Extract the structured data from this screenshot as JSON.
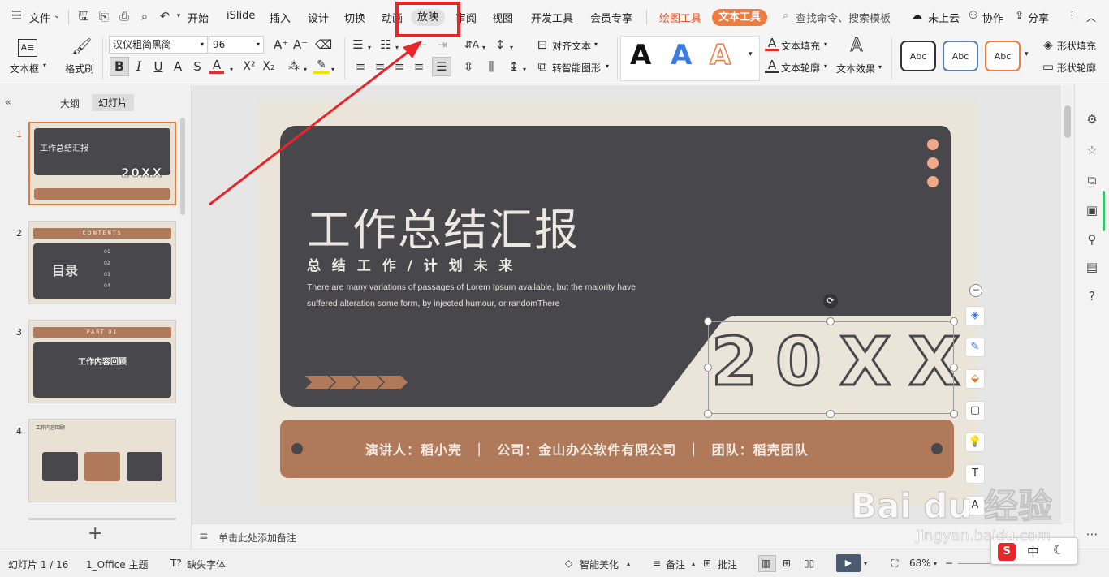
{
  "menu": {
    "file_label": "文件",
    "tabs": [
      "开始",
      "iSlide",
      "插入",
      "设计",
      "切换",
      "动画",
      "放映",
      "审阅",
      "视图",
      "开发工具",
      "会员专享"
    ],
    "active_tab": "放映",
    "drawing_tools": "绘图工具",
    "text_tools": "文本工具",
    "search_placeholder": "查找命令、搜索模板",
    "cloud_label": "未上云",
    "collab_label": "协作",
    "share_label": "分享"
  },
  "ribbon": {
    "textbox_label": "文本框",
    "format_painter_label": "格式刷",
    "font_name": "汉仪粗简黑简",
    "font_size": "96",
    "align_text_label": "对齐文本",
    "smart_shape_label": "转智能图形",
    "text_fill_label": "文本填充",
    "text_outline_label": "文本轮廓",
    "text_effect_label": "文本效果",
    "shape_fill_label": "形状填充",
    "shape_outline_label": "形状轮廓",
    "style_sample": "Abc",
    "wordart_letter": "A"
  },
  "left_pane": {
    "outline_tab": "大纲",
    "slides_tab": "幻灯片",
    "add_label": "+",
    "slides": [
      {
        "num": "1",
        "title": "工作总结汇报",
        "year": "20XX"
      },
      {
        "num": "2",
        "title": "目录",
        "header": "CONTENTS",
        "items": [
          "01",
          "02",
          "03",
          "04"
        ]
      },
      {
        "num": "3",
        "title": "工作内容回顾",
        "header": "PART 01"
      },
      {
        "num": "4",
        "title": "工作内容回顾"
      }
    ]
  },
  "slide": {
    "title": "工作总结汇报",
    "subtitle": "总 结 工 作 / 计 划 未 来",
    "body_line1": "There are many variations of passages of Lorem Ipsum available, but the  majority have",
    "body_line2": "suffered alteration some form, by injected humour, or randomThere",
    "year": "20XX",
    "footer": "演讲人：稻小壳  ｜  公司：金山办公软件有限公司  ｜  团队：稻壳团队"
  },
  "notes_placeholder": "单击此处添加备注",
  "status": {
    "slide_counter": "幻灯片 1 / 16",
    "theme": "1_Office 主题",
    "missing_font": "缺失字体",
    "smart_beautify": "智能美化",
    "notes": "备注",
    "comments": "批注",
    "zoom": "68%"
  },
  "ime": {
    "lang": "中"
  },
  "watermark": {
    "brand": "Bai du 经验",
    "url": "jingyan.baidu.com"
  },
  "colors": {
    "accent_orange": "#f07b3f",
    "slide_dark": "#48474c",
    "slide_brown": "#b07a5a",
    "slide_cream": "#ebe4d9",
    "dot_peach": "#f0a888",
    "highlight_red": "#e8262a"
  }
}
